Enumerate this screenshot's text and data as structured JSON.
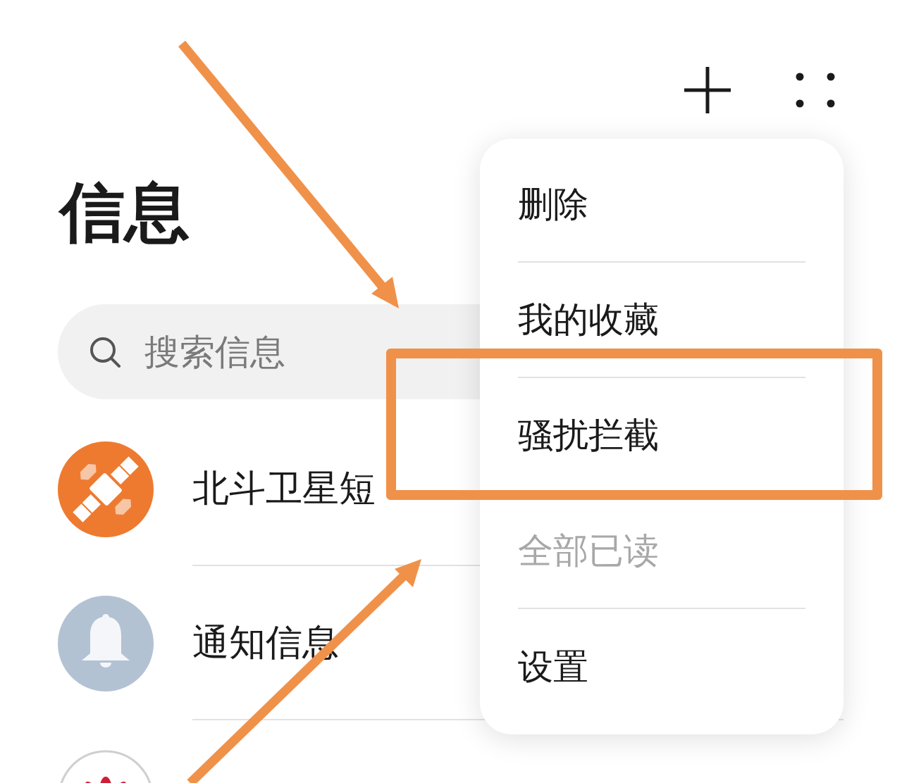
{
  "header": {
    "title": "信息"
  },
  "search": {
    "placeholder": "搜索信息"
  },
  "conversations": [
    {
      "kind": "satellite",
      "name": "北斗卫星短"
    },
    {
      "kind": "bell",
      "name": "通知信息"
    },
    {
      "kind": "logo"
    }
  ],
  "menu": {
    "items": [
      {
        "label": "删除",
        "disabled": false,
        "highlighted": false
      },
      {
        "label": "我的收藏",
        "disabled": false,
        "highlighted": false
      },
      {
        "label": "骚扰拦截",
        "disabled": false,
        "highlighted": true
      },
      {
        "label": "全部已读",
        "disabled": true,
        "highlighted": false
      },
      {
        "label": "设置",
        "disabled": false,
        "highlighted": false
      }
    ]
  }
}
